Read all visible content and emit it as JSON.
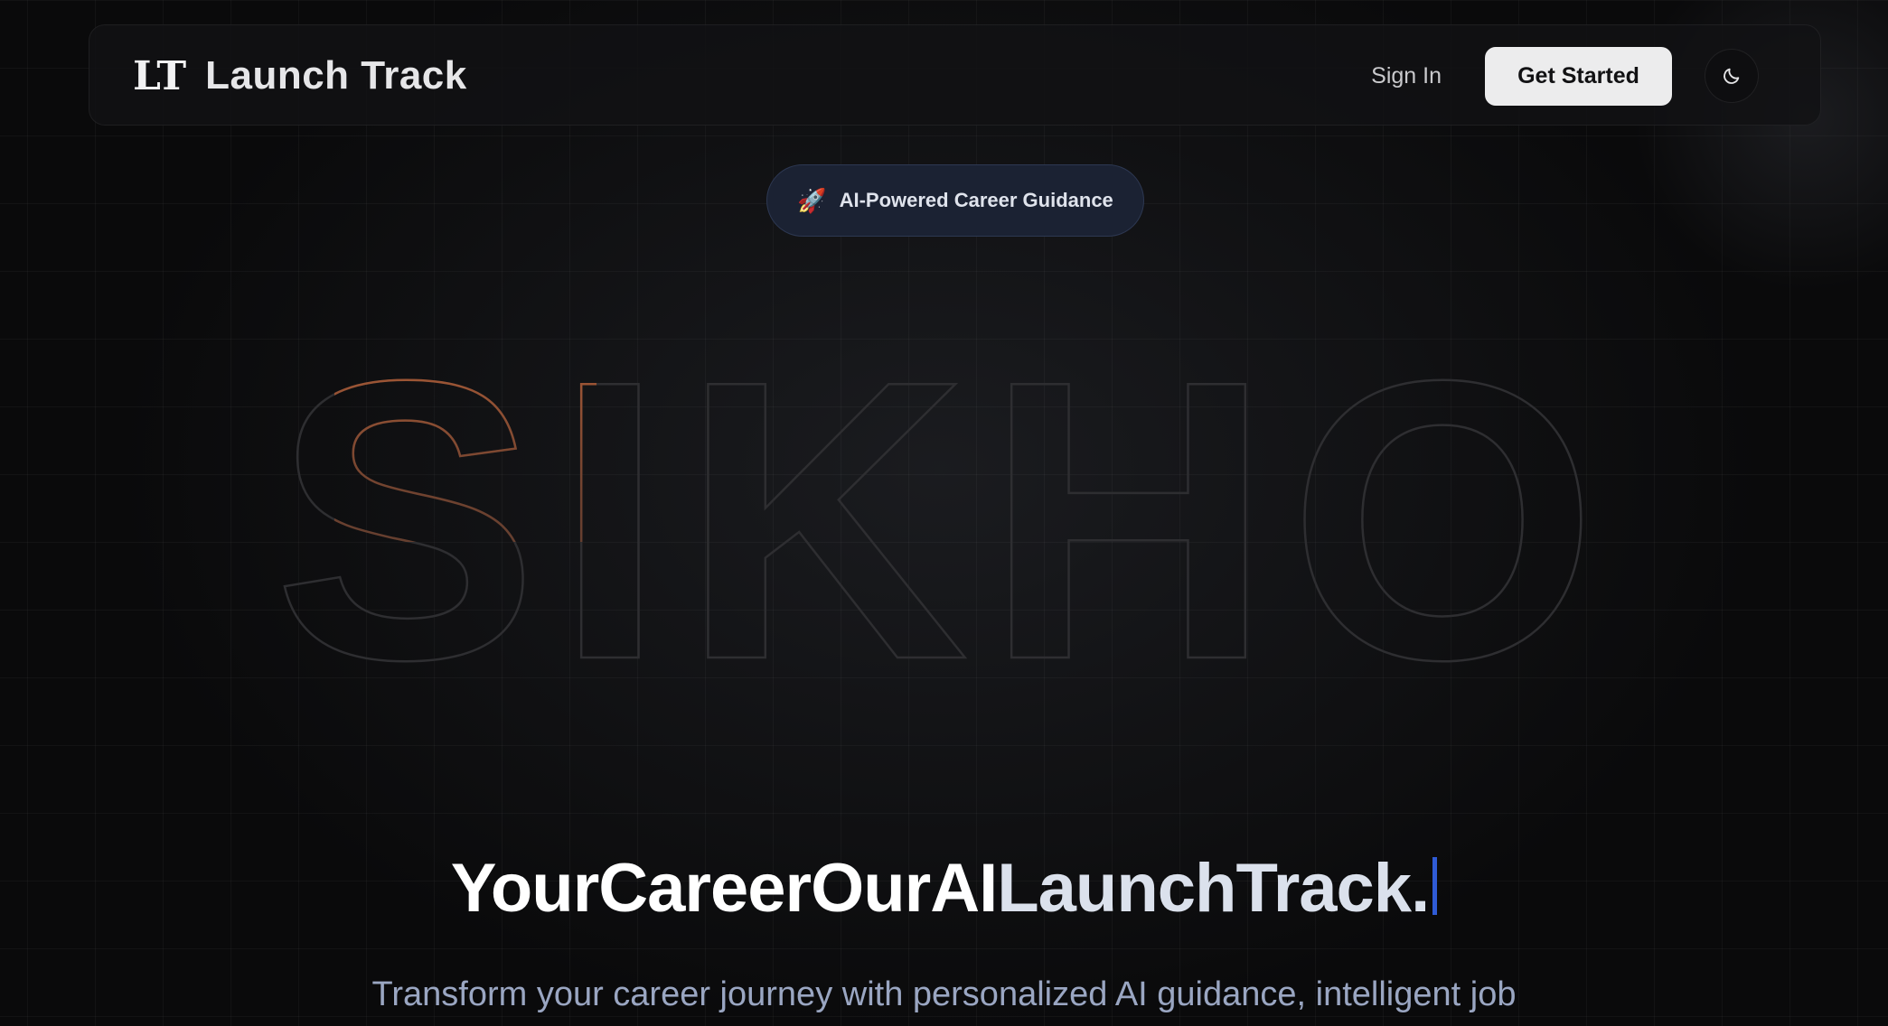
{
  "brand": {
    "mark": "LT",
    "name": "Launch Track"
  },
  "nav": {
    "signin_label": "Sign In",
    "get_started_label": "Get Started",
    "theme_toggle_icon": "moon-icon"
  },
  "badge": {
    "icon": "🚀",
    "icon_name": "rocket-icon",
    "label": "AI-Powered Career Guidance"
  },
  "hero": {
    "outline_word": "SIKHO",
    "headline_part1": "YourCareerOurAI",
    "headline_part2": "LaunchTrack.",
    "subtitle": "Transform your career journey with personalized AI guidance, intelligent job"
  },
  "colors": {
    "background": "#0a0a0b",
    "accent_orange": "#c9683a",
    "badge_bg": "#1b2233",
    "cursor_blue": "#2f5bd6",
    "button_bg": "#ececed"
  }
}
